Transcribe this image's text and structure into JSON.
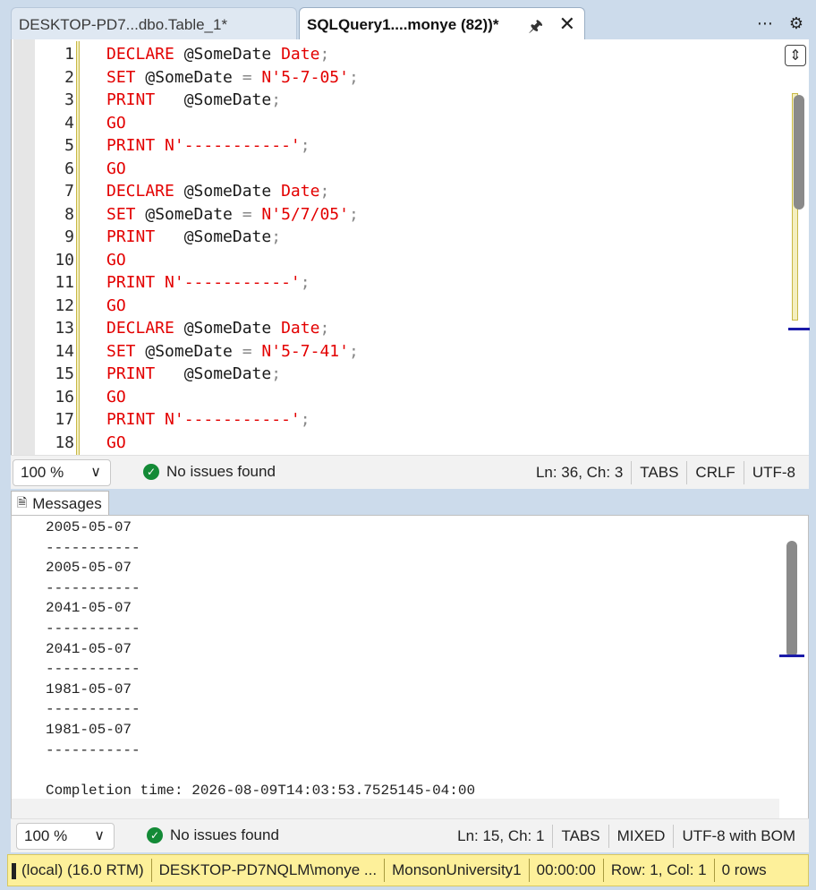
{
  "tabs": [
    {
      "label": "DESKTOP-PD7...dbo.Table_1*",
      "active": false
    },
    {
      "label": "SQLQuery1....monye (82))*",
      "active": true
    }
  ],
  "tab_icons": {
    "pin": "pin-icon",
    "close": "close-icon",
    "more": "more-icon",
    "settings": "gear-icon"
  },
  "editor": {
    "line_numbers": [
      "1",
      "2",
      "3",
      "4",
      "5",
      "6",
      "7",
      "8",
      "9",
      "10",
      "11",
      "12",
      "13",
      "14",
      "15",
      "16",
      "17",
      "18"
    ],
    "lines": [
      [
        {
          "t": "DECLARE ",
          "c": "kw"
        },
        {
          "t": "@SomeDate ",
          "c": "var"
        },
        {
          "t": "Date",
          "c": "typ"
        },
        {
          "t": ";",
          "c": "punc"
        }
      ],
      [
        {
          "t": "SET ",
          "c": "kw"
        },
        {
          "t": "@SomeDate ",
          "c": "var"
        },
        {
          "t": "= ",
          "c": "punc"
        },
        {
          "t": "N'5-7-05'",
          "c": "str"
        },
        {
          "t": ";",
          "c": "punc"
        }
      ],
      [
        {
          "t": "PRINT   ",
          "c": "kw"
        },
        {
          "t": "@SomeDate",
          "c": "var"
        },
        {
          "t": ";",
          "c": "punc"
        }
      ],
      [
        {
          "t": "GO",
          "c": "kw"
        }
      ],
      [
        {
          "t": "PRINT ",
          "c": "kw"
        },
        {
          "t": "N'-----------'",
          "c": "str"
        },
        {
          "t": ";",
          "c": "punc"
        }
      ],
      [
        {
          "t": "GO",
          "c": "kw"
        }
      ],
      [
        {
          "t": "DECLARE ",
          "c": "kw"
        },
        {
          "t": "@SomeDate ",
          "c": "var"
        },
        {
          "t": "Date",
          "c": "typ"
        },
        {
          "t": ";",
          "c": "punc"
        }
      ],
      [
        {
          "t": "SET ",
          "c": "kw"
        },
        {
          "t": "@SomeDate ",
          "c": "var"
        },
        {
          "t": "= ",
          "c": "punc"
        },
        {
          "t": "N'5/7/05'",
          "c": "str"
        },
        {
          "t": ";",
          "c": "punc"
        }
      ],
      [
        {
          "t": "PRINT   ",
          "c": "kw"
        },
        {
          "t": "@SomeDate",
          "c": "var"
        },
        {
          "t": ";",
          "c": "punc"
        }
      ],
      [
        {
          "t": "GO",
          "c": "kw"
        }
      ],
      [
        {
          "t": "PRINT ",
          "c": "kw"
        },
        {
          "t": "N'-----------'",
          "c": "str"
        },
        {
          "t": ";",
          "c": "punc"
        }
      ],
      [
        {
          "t": "GO",
          "c": "kw"
        }
      ],
      [
        {
          "t": "DECLARE ",
          "c": "kw"
        },
        {
          "t": "@SomeDate ",
          "c": "var"
        },
        {
          "t": "Date",
          "c": "typ"
        },
        {
          "t": ";",
          "c": "punc"
        }
      ],
      [
        {
          "t": "SET ",
          "c": "kw"
        },
        {
          "t": "@SomeDate ",
          "c": "var"
        },
        {
          "t": "= ",
          "c": "punc"
        },
        {
          "t": "N'5-7-41'",
          "c": "str"
        },
        {
          "t": ";",
          "c": "punc"
        }
      ],
      [
        {
          "t": "PRINT   ",
          "c": "kw"
        },
        {
          "t": "@SomeDate",
          "c": "var"
        },
        {
          "t": ";",
          "c": "punc"
        }
      ],
      [
        {
          "t": "GO",
          "c": "kw"
        }
      ],
      [
        {
          "t": "PRINT ",
          "c": "kw"
        },
        {
          "t": "N'-----------'",
          "c": "str"
        },
        {
          "t": ";",
          "c": "punc"
        }
      ],
      [
        {
          "t": "GO",
          "c": "kw"
        }
      ]
    ]
  },
  "editor_status": {
    "zoom": "100 %",
    "issues": "No issues found",
    "position": "Ln: 36, Ch: 3",
    "indent": "TABS",
    "line_ending": "CRLF",
    "encoding": "UTF-8"
  },
  "messages": {
    "tab_label": "Messages",
    "lines": [
      "2005-05-07",
      "-----------",
      "2005-05-07",
      "-----------",
      "2041-05-07",
      "-----------",
      "2041-05-07",
      "-----------",
      "1981-05-07",
      "-----------",
      "1981-05-07",
      "-----------",
      "",
      "Completion time: 2026-08-09T14:03:53.7525145-04:00"
    ]
  },
  "messages_status": {
    "zoom": "100 %",
    "issues": "No issues found",
    "position": "Ln: 15, Ch: 1",
    "indent": "TABS",
    "line_ending": "MIXED",
    "encoding": "UTF-8 with BOM"
  },
  "connection_bar": {
    "server": "(local) (16.0 RTM)",
    "user": "DESKTOP-PD7NQLM\\monye ...",
    "database": "MonsonUniversity1",
    "elapsed": "00:00:00",
    "rowcol": "Row: 1, Col: 1",
    "rows": "0 rows"
  },
  "colors": {
    "keyword": "#e30000",
    "status_bar": "#fdf09a",
    "ok": "#138a36"
  }
}
